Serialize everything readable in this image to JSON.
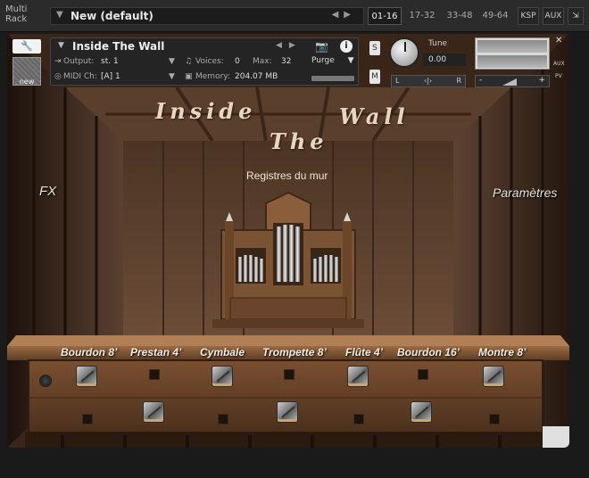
{
  "rack": {
    "label": "Multi Rack",
    "name": "New (default)",
    "pages": [
      "01-16",
      "17-32",
      "33-48",
      "49-64"
    ],
    "active_page": "01-16",
    "ksp_label": "KSP",
    "aux_label": "AUX"
  },
  "instrument": {
    "name": "Inside The Wall",
    "new_badge": "new",
    "output_label": "Output:",
    "output_value": "st. 1",
    "voices_label": "Voices:",
    "voices_value": "0",
    "max_label": "Max:",
    "max_value": "32",
    "purge_label": "Purge",
    "midi_label": "MIDI Ch:",
    "midi_value": "[A]  1",
    "memory_label": "Memory:",
    "memory_value": "204.07 MB",
    "solo_label": "S",
    "mute_label": "M",
    "tune_label": "Tune",
    "tune_value": "0.00",
    "pan_left": "L",
    "pan_right": "R",
    "vol_minus": "-",
    "vol_plus": "+",
    "aux_side": "AUX",
    "pv_side": "PV"
  },
  "gui": {
    "title_words": [
      "Inside",
      "The",
      "Wall"
    ],
    "subtitle": "Registres du mur",
    "fx_label": "FX",
    "params_label": "Paramètres",
    "stops": [
      "Bourdon 8’",
      "Prestan 4’",
      "Cymbale",
      "Trompette 8’",
      "Flûte 4’",
      "Bourdon 16’",
      "Montre 8’"
    ]
  }
}
